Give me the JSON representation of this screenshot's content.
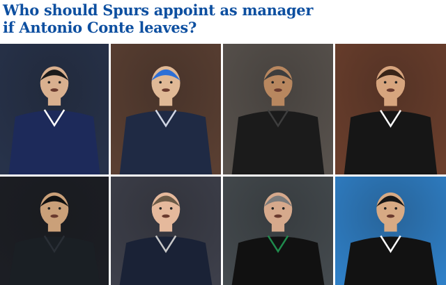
{
  "headline": {
    "line1": "Who should Spurs appoint as manager",
    "line2": "if Antonio Conte leaves?"
  },
  "photos": [
    {
      "name": "photo-1",
      "bg": "#27324a",
      "skin": "#d9b08f",
      "hair": "#1a1a1a",
      "top": "#1d2a5a",
      "accent": "#ffffff"
    },
    {
      "name": "photo-2",
      "bg": "#5a3f32",
      "skin": "#e0b996",
      "hair": "#2d6fd6",
      "top": "#1f2a44",
      "accent": "#d0d6e4"
    },
    {
      "name": "photo-3",
      "bg": "#58524d",
      "skin": "#b8875f",
      "hair": "#3d3d3d",
      "top": "#1b1b1b",
      "accent": "#3d3d3d"
    },
    {
      "name": "photo-4",
      "bg": "#6a3e2c",
      "skin": "#d7a57e",
      "hair": "#3a2518",
      "top": "#161616",
      "accent": "#ffffff"
    },
    {
      "name": "photo-5",
      "bg": "#1c1e24",
      "skin": "#caa079",
      "hair": "#111111",
      "top": "#1a1f24",
      "accent": "#2a2f36"
    },
    {
      "name": "photo-6",
      "bg": "#3d3f4a",
      "skin": "#e5b99c",
      "hair": "#6b5a46",
      "top": "#1a2236",
      "accent": "#c8c8c8"
    },
    {
      "name": "photo-7",
      "bg": "#444a4e",
      "skin": "#d6a98c",
      "hair": "#7b7b7b",
      "top": "#111111",
      "accent": "#1f8a4c"
    },
    {
      "name": "photo-8",
      "bg": "#2f7fc6",
      "skin": "#d7aa84",
      "hair": "#161616",
      "top": "#121212",
      "accent": "#ffffff"
    }
  ]
}
